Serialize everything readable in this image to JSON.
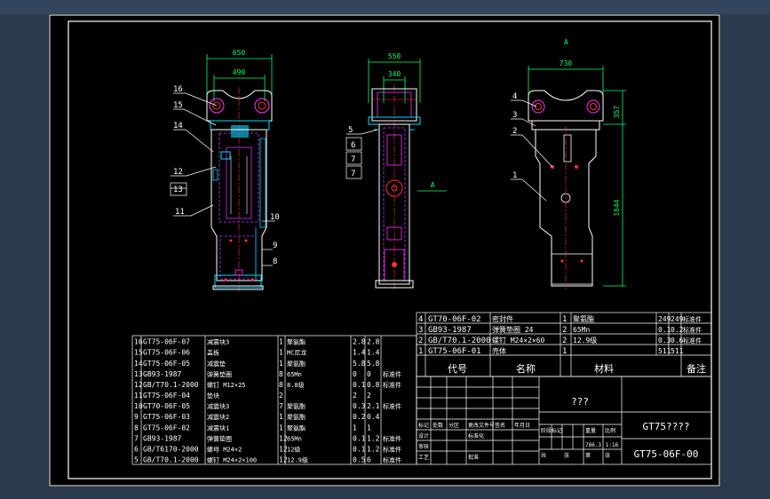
{
  "colors": {
    "background": "#000000",
    "frame": "#ffffff",
    "outline": "#ffffff",
    "dimension": "#00ff66",
    "hidden": "#cc33ff",
    "center": "#ff3333",
    "leader": "#ffffff",
    "cyan": "#00d8ff",
    "magenta": "#ff33ff"
  },
  "views": {
    "front": {
      "dim_top": "650",
      "dim_inner": "490",
      "callouts_left": [
        "16",
        "15",
        "14",
        "12",
        "13",
        "11"
      ],
      "callouts_right": [
        "10",
        "9",
        "8"
      ]
    },
    "side": {
      "dim_top": "550",
      "dim_inner": "340",
      "callouts_left": [
        "5",
        "6",
        "7"
      ],
      "section_mark": "A"
    },
    "right": {
      "label_top": "A",
      "dim_top": "730",
      "dim_right_upper": "357",
      "dim_right_lower": "1644",
      "callouts_left": [
        "4",
        "3",
        "2",
        "1"
      ]
    }
  },
  "bom_upper": [
    {
      "no": "4",
      "code": "GT70-06F-02",
      "name": "密封件",
      "qty": "1",
      "material": "聚氨酯",
      "w1": "249",
      "w2": "249",
      "note": "标准件"
    },
    {
      "no": "3",
      "code": "GB93-1987",
      "name": "弹簧垫圈 24",
      "qty": "2",
      "material": "65Mn",
      "w1": "0.1",
      "w2": "0.2",
      "note": "标准件"
    },
    {
      "no": "2",
      "code": "GB/T70.1-2000",
      "name": "螺钉 M24×2×60",
      "qty": "2",
      "material": "12.9级",
      "w1": "0.3",
      "w2": "0.6",
      "note": "标准件"
    },
    {
      "no": "1",
      "code": "GT75-06F-01",
      "name": "壳体",
      "qty": "1",
      "material": "",
      "w1": "511",
      "w2": "511",
      "note": ""
    }
  ],
  "bom_header": {
    "code": "代号",
    "name": "名称",
    "material": "材料",
    "note": "备注"
  },
  "bom_lower": [
    {
      "no": "16",
      "code": "GT75-06F-07",
      "name": "减震块3",
      "qty": "1",
      "material": "聚氨酯",
      "w1": "2.8",
      "w2": "2.8",
      "note": ""
    },
    {
      "no": "15",
      "code": "GT75-06F-06",
      "name": "盖板",
      "qty": "1",
      "material": "MC尼龙",
      "w1": "1.4",
      "w2": "1.4",
      "note": ""
    },
    {
      "no": "14",
      "code": "GT75-06F-05",
      "name": "减震垫",
      "qty": "1",
      "material": "聚氨酯",
      "w1": "5.8",
      "w2": "5.8",
      "note": ""
    },
    {
      "no": "13",
      "code": "GB93-1987",
      "name": "弹簧垫圈",
      "qty": "8",
      "material": "65Mn",
      "w1": "0",
      "w2": "0",
      "note": "标准件"
    },
    {
      "no": "12",
      "code": "GB/T70.1-2000",
      "name": "螺钉 M12×25",
      "qty": "8",
      "material": "8.8级",
      "w1": "0.1",
      "w2": "0.8",
      "note": "标准件"
    },
    {
      "no": "11",
      "code": "GT75-06F-04",
      "name": "垫块",
      "qty": "2",
      "material": "",
      "w1": "2",
      "w2": "2",
      "note": ""
    },
    {
      "no": "10",
      "code": "GT70-06F-05",
      "name": "减震块3",
      "qty": "7",
      "material": "聚氨酯",
      "w1": "0.3",
      "w2": "2.1",
      "note": "标准件"
    },
    {
      "no": "9",
      "code": "GT75-06F-03",
      "name": "减震块2",
      "qty": "1",
      "material": "聚氨酯",
      "w1": "0.2",
      "w2": "0.4",
      "note": ""
    },
    {
      "no": "8",
      "code": "GT75-06F-02",
      "name": "减震块1",
      "qty": "1",
      "material": "聚氨酯",
      "w1": "1",
      "w2": "1",
      "note": ""
    },
    {
      "no": "7",
      "code": "GB93-1987",
      "name": "弹簧垫圈",
      "qty": "12",
      "material": "65Mn",
      "w1": "0.1",
      "w2": "1.2",
      "note": "标准件"
    },
    {
      "no": "6",
      "code": "GB/T6170-2000",
      "name": "螺母 M24×2",
      "qty": "12",
      "material": "12级",
      "w1": "0.1",
      "w2": "1.2",
      "note": "标准件"
    },
    {
      "no": "5",
      "code": "GB/T70.1-2000",
      "name": "螺钉 M24×2×100",
      "qty": "12",
      "material": "12.9级",
      "w1": "0.5",
      "w2": "6",
      "note": "标准件"
    }
  ],
  "title_block": {
    "org": "???",
    "drawing_title": "GT75????",
    "drawing_no": "GT75-06F-00",
    "weight": "786.3",
    "scale": "1:16",
    "labels": [
      "标记",
      "处数",
      "分区",
      "更改文件号",
      "签名",
      "年月日",
      "设计",
      "标准化",
      "审核",
      "工艺",
      "批准",
      "阶段标记",
      "重量",
      "比例",
      "共",
      "张",
      "第",
      "张"
    ]
  }
}
